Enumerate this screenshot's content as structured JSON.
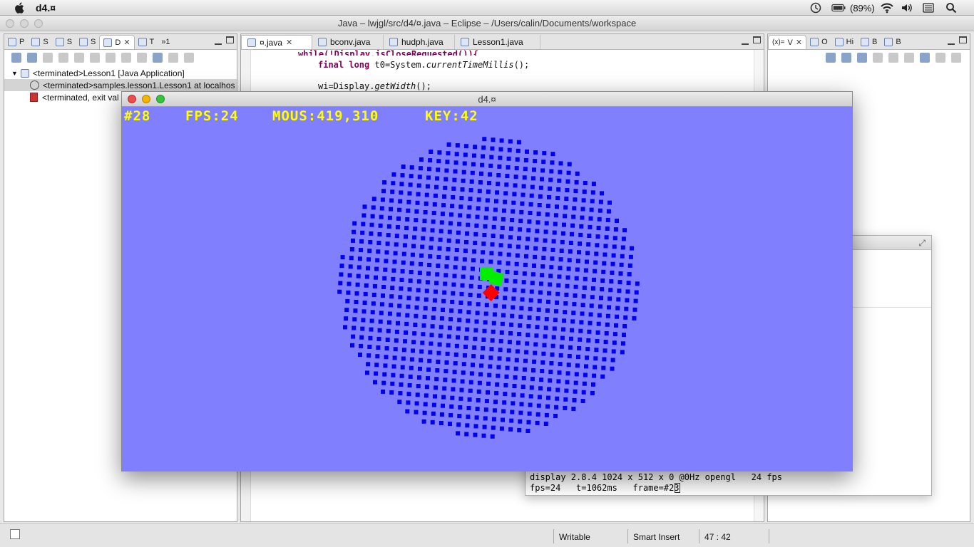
{
  "menubar": {
    "app_name": "d4.¤",
    "battery": "(89%)"
  },
  "eclipse": {
    "title": "Java – lwjgl/src/d4/¤.java – Eclipse – /Users/calin/Documents/workspace",
    "left_tabs": [
      "P",
      "S",
      "S",
      "S",
      "D",
      "T",
      "»1"
    ],
    "editor_tabs": [
      "¤.java",
      "bconv.java",
      "hudph.java",
      "Lesson1.java"
    ],
    "right_tabs": [
      "V",
      "O",
      "Hi",
      "B",
      "B"
    ],
    "debug_tree": [
      "<terminated>Lesson1 [Java Application]",
      "<terminated>samples.lesson1.Lesson1 at localhos",
      "<terminated, exit val"
    ],
    "code": {
      "line0": "while(!Display.isCloseRequested()){",
      "line1_kw1": "final",
      "line1_kw2": "long",
      "line1_rest": " t0=System.",
      "line1_method": "currentTimeMillis",
      "line1_end": "();",
      "line2_start": "wi=Display.",
      "line2_method": "getWidth",
      "line2_end": "();"
    }
  },
  "statusbar": {
    "writable": "Writable",
    "insert_mode": "Smart Insert",
    "position": "47 : 42"
  },
  "console": {
    "line1": "display 2.8.4 1024 x 512 x 0 @0Hz opengl   24 fps",
    "line2": "fps=24   t=1062ms   frame=#23"
  },
  "game": {
    "window_title": "d4.¤",
    "hud_frame": "#28",
    "hud_fps": "FPS:24",
    "hud_mouse": "MOUS:419,310",
    "hud_key": "KEY:42",
    "colors": {
      "background": "#8080ff",
      "dots": "#0000ee",
      "player": "#00ee00",
      "marker": "#ff0000",
      "hud": "#ffff00"
    }
  }
}
